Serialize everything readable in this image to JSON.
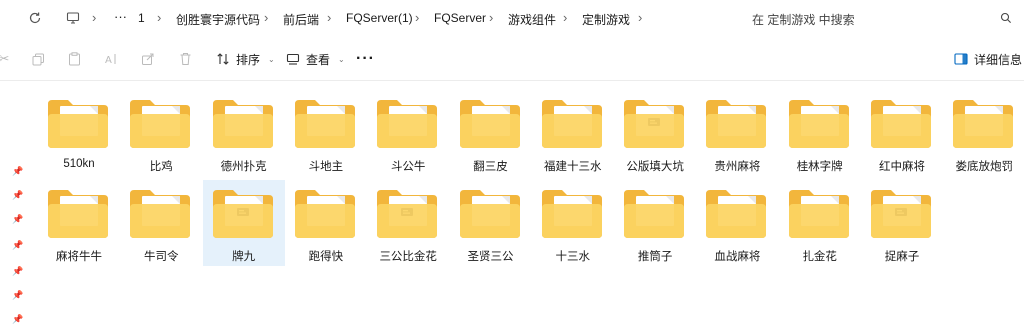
{
  "breadcrumb": {
    "items": [
      "1",
      "创胜寰宇源代码",
      "前后端",
      "FQServer(1)",
      "FQServer",
      "游戏组件",
      "定制游戏"
    ]
  },
  "search": {
    "placeholder": "在 定制游戏 中搜索"
  },
  "toolbar": {
    "sort_label": "排序",
    "view_label": "查看",
    "details_label": "详细信息"
  },
  "folders": [
    {
      "name": "510kn",
      "doc": "blank"
    },
    {
      "name": "比鸡",
      "doc": "blank"
    },
    {
      "name": "德州扑克",
      "doc": "blank"
    },
    {
      "name": "斗地主",
      "doc": "blank"
    },
    {
      "name": "斗公牛",
      "doc": "blank"
    },
    {
      "name": "翻三皮",
      "doc": "blank"
    },
    {
      "name": "福建十三水",
      "doc": "blank"
    },
    {
      "name": "公版填大坑",
      "doc": "text"
    },
    {
      "name": "贵州麻将",
      "doc": "blank"
    },
    {
      "name": "桂林字牌",
      "doc": "blank"
    },
    {
      "name": "红中麻将",
      "doc": "blank"
    },
    {
      "name": "娄底放炮罚",
      "doc": "blank"
    },
    {
      "name": "麻将牛牛",
      "doc": "blank"
    },
    {
      "name": "牛司令",
      "doc": "blank"
    },
    {
      "name": "牌九",
      "doc": "text",
      "selected": true
    },
    {
      "name": "跑得快",
      "doc": "blank"
    },
    {
      "name": "三公比金花",
      "doc": "text"
    },
    {
      "name": "圣贤三公",
      "doc": "blank"
    },
    {
      "name": "十三水",
      "doc": "blank"
    },
    {
      "name": "推筒子",
      "doc": "blank"
    },
    {
      "name": "血战麻将",
      "doc": "blank"
    },
    {
      "name": "扎金花",
      "doc": "blank"
    },
    {
      "name": "捉麻子",
      "doc": "text"
    }
  ],
  "colors": {
    "folder_back": "#F2B63C",
    "folder_front": "#FCD462",
    "selection": "#E5F1FB",
    "accent": "#0067C0"
  }
}
